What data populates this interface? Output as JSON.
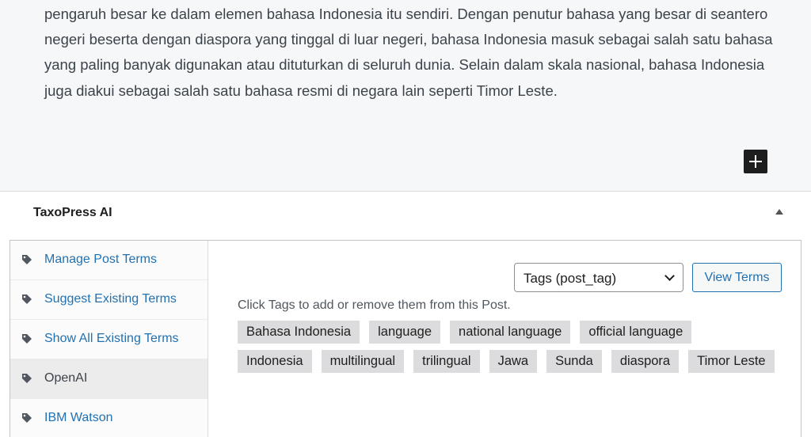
{
  "editor": {
    "paragraph": "pengaruh besar ke dalam elemen bahasa Indonesia itu sendiri. Dengan penutur bahasa yang besar di seantero negeri beserta dengan diaspora yang tinggal di luar negeri, bahasa Indonesia masuk sebagai salah satu bahasa yang paling banyak digunakan atau dituturkan di seluruh dunia. Selain dalam skala nasional, bahasa Indonesia juga diakui sebagai salah satu bahasa resmi di negara lain seperti Timor Leste."
  },
  "panel": {
    "title": "TaxoPress AI"
  },
  "sidebar": {
    "items": [
      {
        "label": "Manage Post Terms"
      },
      {
        "label": "Suggest Existing Terms"
      },
      {
        "label": "Show All Existing Terms"
      },
      {
        "label": "OpenAI"
      },
      {
        "label": "IBM Watson"
      }
    ]
  },
  "content": {
    "select_value": "Tags (post_tag)",
    "view_button": "View Terms",
    "instruction": "Click Tags to add or remove them from this Post.",
    "terms": [
      "Bahasa Indonesia",
      "language",
      "national language",
      "official language",
      "Indonesia",
      "multilingual",
      "trilingual",
      "Jawa",
      "Sunda",
      "diaspora",
      "Timor Leste"
    ]
  },
  "colors": {
    "link": "#2271b1",
    "tag_bg": "#dcdcde",
    "active_bg": "#ececec"
  }
}
